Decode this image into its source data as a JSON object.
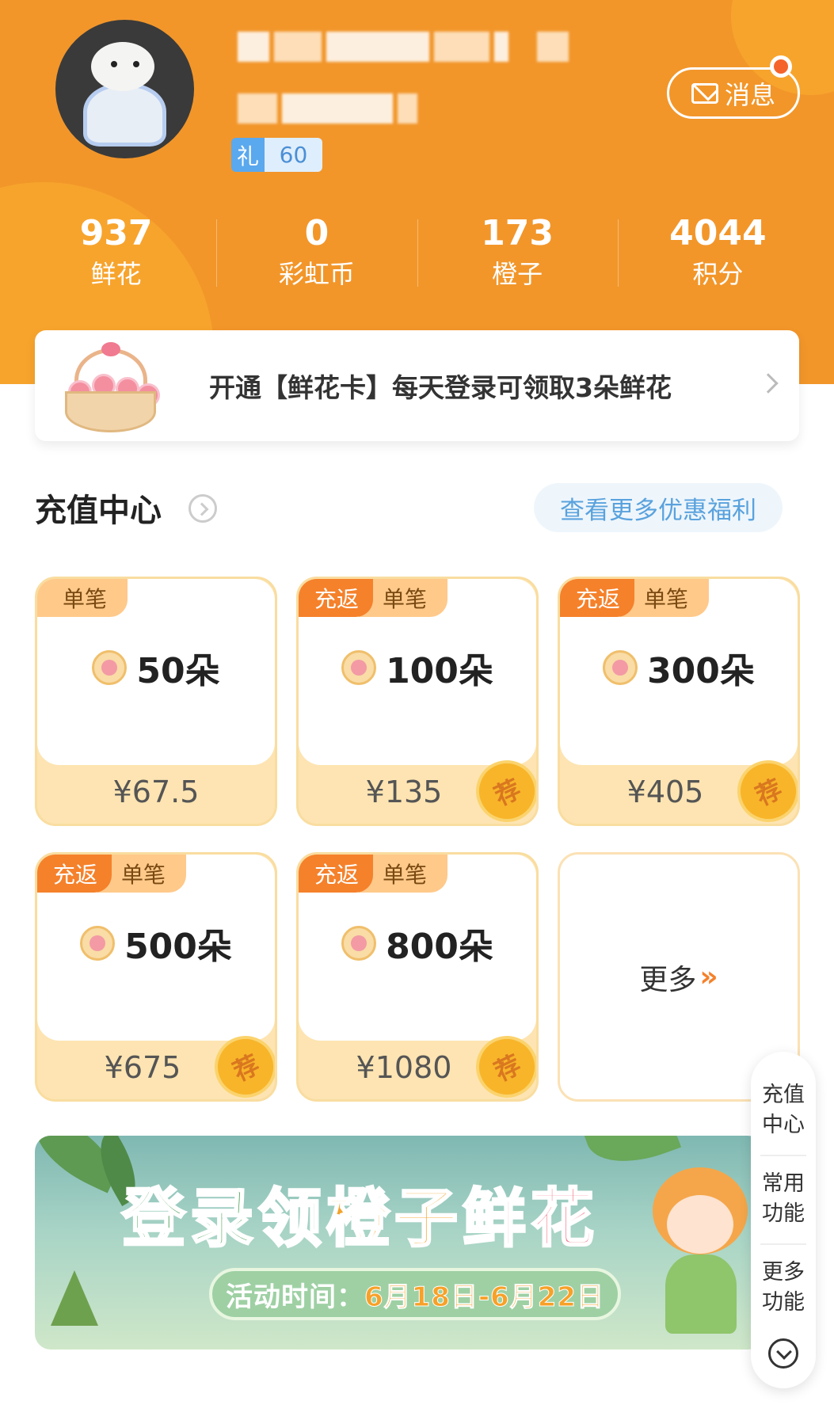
{
  "profile": {
    "badge_gift": "礼",
    "badge_level": "60",
    "message_label": "消息"
  },
  "stats": [
    {
      "value": "937",
      "label": "鲜花"
    },
    {
      "value": "0",
      "label": "彩虹币"
    },
    {
      "value": "173",
      "label": "橙子"
    },
    {
      "value": "4044",
      "label": "积分"
    }
  ],
  "flower_card": {
    "text": "开通【鲜花卡】每天登录可领取3朵鲜花"
  },
  "recharge": {
    "title": "充值中心",
    "more_deals": "查看更多优惠福利",
    "tag_fan": "充返",
    "tag_dan": "单笔",
    "rec_badge": "荐",
    "packages": [
      {
        "amount": "50朵",
        "price": "¥67.5"
      },
      {
        "amount": "100朵",
        "price": "¥135"
      },
      {
        "amount": "300朵",
        "price": "¥405"
      },
      {
        "amount": "500朵",
        "price": "¥675"
      },
      {
        "amount": "800朵",
        "price": "¥1080"
      }
    ],
    "more_label": "更多",
    "more_arrow": "»"
  },
  "promo": {
    "title_part1": "登录领",
    "title_part2": "橙子",
    "title_part3": "鲜花",
    "date_prefix": "活动时间：",
    "date_range": "6月18日-6月22日"
  },
  "side_nav": {
    "items": [
      "充值中心",
      "常用功能",
      "更多功能"
    ]
  },
  "colors": {
    "header": "#f2962a",
    "accent": "#f5812b",
    "card_bg": "#fde4b2",
    "link_blue": "#5aa2dd"
  }
}
